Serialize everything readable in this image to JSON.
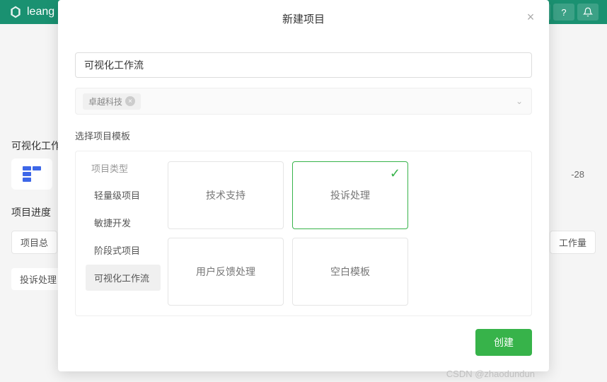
{
  "header": {
    "logo_text": "leang",
    "help_label": "?",
    "date_fragment": "-28"
  },
  "background": {
    "section1_title": "可视化工作",
    "section2_title": "项目进度",
    "pill1": "项目总",
    "pill2": "工作量",
    "pill3": "投诉处理"
  },
  "modal": {
    "title": "新建项目",
    "name_input_value": "可视化工作流",
    "tag": {
      "label": "卓越科技"
    },
    "section_label": "选择项目模板",
    "type_column_title": "项目类型",
    "types": [
      {
        "label": "轻量级项目",
        "active": false
      },
      {
        "label": "敏捷开发",
        "active": false
      },
      {
        "label": "阶段式项目",
        "active": false
      },
      {
        "label": "可视化工作流",
        "active": true
      }
    ],
    "templates": [
      {
        "label": "技术支持",
        "selected": false
      },
      {
        "label": "投诉处理",
        "selected": true
      },
      {
        "label": "用户反馈处理",
        "selected": false
      },
      {
        "label": "空白模板",
        "selected": false
      }
    ],
    "create_button": "创建"
  },
  "watermark": "CSDN @zhaodundun"
}
